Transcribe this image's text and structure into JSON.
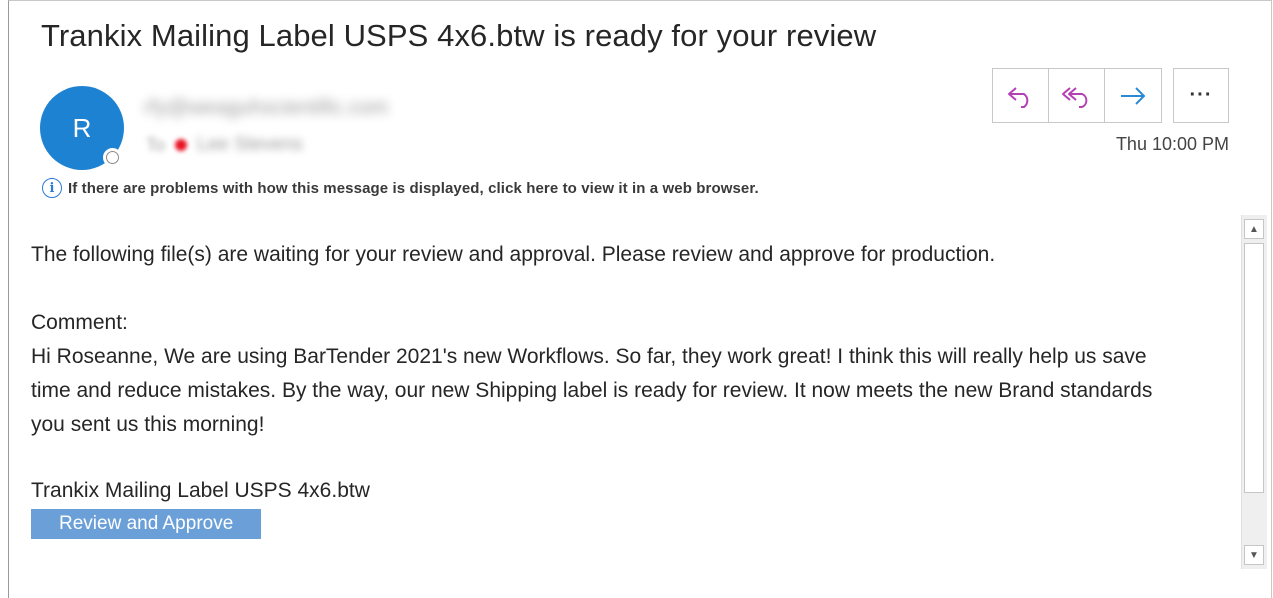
{
  "message": {
    "subject": "Trankix Mailing Label USPS 4x6.btw is ready for your review",
    "avatar_initial": "R",
    "sender": "rfy@weaguhscientific.com",
    "to_label": "To",
    "recipient": "Lee Stevens",
    "timestamp": "Thu 10:00 PM"
  },
  "actions": {
    "reply_icon": "reply-icon",
    "reply_all_icon": "reply-all-icon",
    "forward_icon": "forward-icon",
    "more_label": "···"
  },
  "info_bar": {
    "icon": "i",
    "text": "If there are problems with how this message is displayed, click here to view it in a web browser."
  },
  "body": {
    "intro": "The following file(s) are waiting for your review and approval. Please review and approve for production.",
    "comment_label": "Comment:",
    "comment_text": "Hi Roseanne, We are using BarTender 2021's new Workflows. So far, they work great! I think this will really help us save time and reduce mistakes. By the way, our new Shipping label is ready for review. It now meets the new Brand standards you sent us this morning!",
    "file_name": "Trankix Mailing Label USPS 4x6.btw",
    "review_button": "Review and Approve"
  },
  "colors": {
    "avatar": "#1e82d2",
    "reply_icons": "#b53fb5",
    "forward_icon": "#2b8ad6",
    "review_button": "#6a9fd8"
  }
}
